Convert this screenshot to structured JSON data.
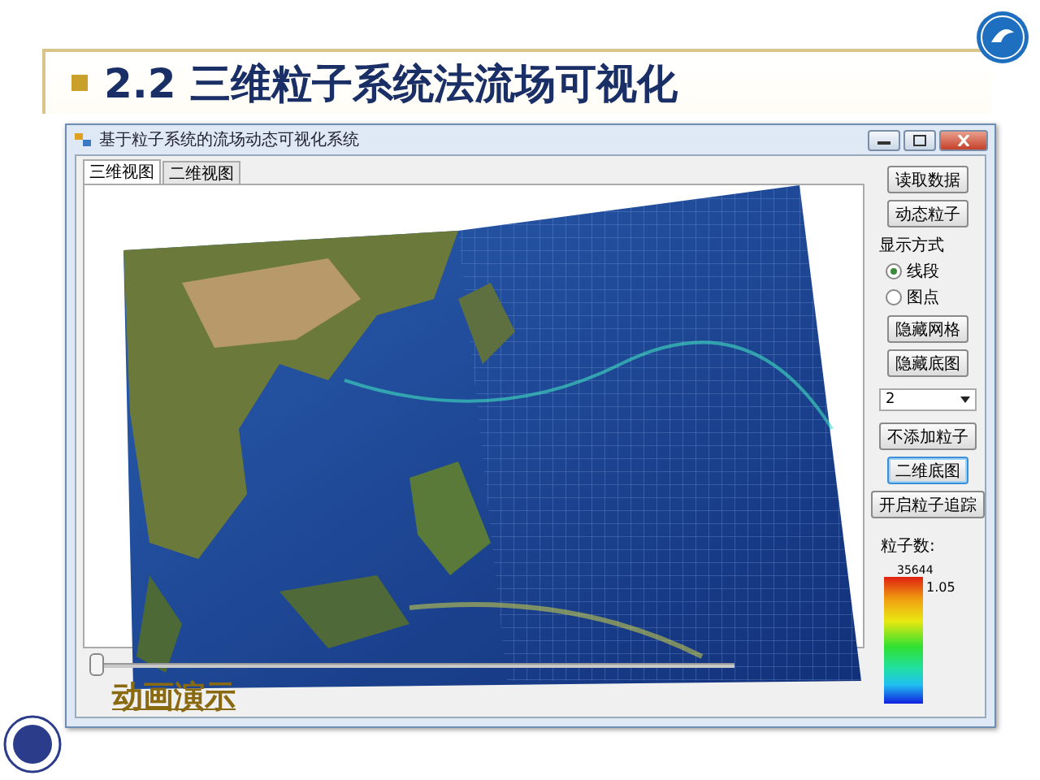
{
  "slide": {
    "title": "2.2 三维粒子系统法流场可视化"
  },
  "window": {
    "title": "基于粒子系统的流场动态可视化系统",
    "tabs": [
      {
        "label": "三维视图",
        "selected": true
      },
      {
        "label": "二维视图",
        "selected": false
      }
    ],
    "buttons_top": [
      "读取数据",
      "动态粒子"
    ],
    "display_mode": {
      "label": "显示方式",
      "options": [
        {
          "label": "线段",
          "selected": true
        },
        {
          "label": "图点",
          "selected": false
        }
      ]
    },
    "buttons_middle": [
      "隐藏网格",
      "隐藏底图"
    ],
    "dropdown": {
      "value": "2"
    },
    "buttons_bottom": [
      {
        "label": "不添加粒子",
        "focused": false
      },
      {
        "label": "二维底图",
        "focused": true
      },
      {
        "label": "开启粒子追踪",
        "focused": false
      }
    ],
    "particle_count": {
      "label": "粒子数:",
      "value": "35644"
    },
    "color_scale": {
      "max_label": "1.05"
    },
    "animation_slider": {
      "level": 0
    }
  },
  "annotation": "动画演示"
}
